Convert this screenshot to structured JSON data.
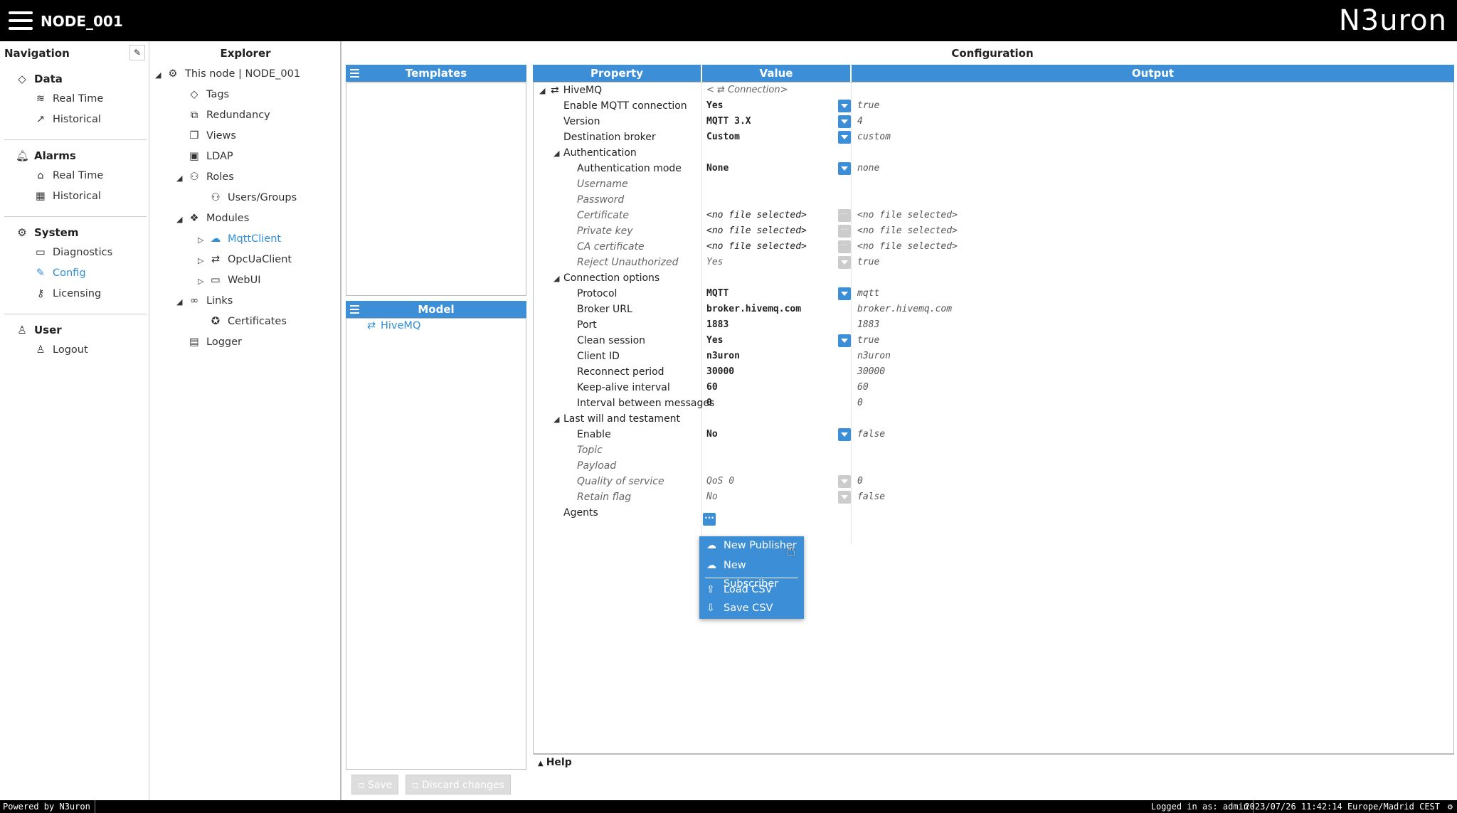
{
  "header": {
    "node_name": "NODE_001",
    "logo": "N3uron"
  },
  "navigation": {
    "title": "Navigation",
    "sections": [
      {
        "label": "Data",
        "icon": "tag-icon",
        "items": [
          {
            "label": "Real Time",
            "icon": "rss-icon"
          },
          {
            "label": "Historical",
            "icon": "chart-line-icon"
          }
        ]
      },
      {
        "label": "Alarms",
        "icon": "bell-icon",
        "items": [
          {
            "label": "Real Time",
            "icon": "alarm-rt-icon"
          },
          {
            "label": "Historical",
            "icon": "table-icon"
          }
        ]
      },
      {
        "label": "System",
        "icon": "gear-icon",
        "items": [
          {
            "label": "Diagnostics",
            "icon": "diagnostics-icon"
          },
          {
            "label": "Config",
            "icon": "edit-icon"
          },
          {
            "label": "Licensing",
            "icon": "key-icon"
          }
        ]
      },
      {
        "label": "User",
        "icon": "user-icon",
        "items": [
          {
            "label": "Logout",
            "icon": "logout-icon"
          }
        ]
      }
    ]
  },
  "explorer": {
    "title": "Explorer",
    "items": [
      "This node | NODE_001",
      "Tags",
      "Redundancy",
      "Views",
      "LDAP",
      "Roles",
      "Users/Groups",
      "Modules",
      "MqttClient",
      "OpcUaClient",
      "WebUI",
      "Links",
      "Certificates",
      "Logger"
    ]
  },
  "templates": {
    "title": "Templates"
  },
  "model": {
    "title": "Model",
    "item": "HiveMQ"
  },
  "configuration": {
    "title": "Configuration",
    "columns": {
      "property": "Property",
      "value": "Value",
      "output": "Output"
    },
    "root": {
      "label": "HiveMQ",
      "value": "< ⇄ Connection>"
    },
    "rows": [
      {
        "p": "Enable MQTT connection",
        "v": "Yes",
        "o": "true"
      },
      {
        "p": "Version",
        "v": "MQTT 3.X",
        "o": "4"
      },
      {
        "p": "Destination broker",
        "v": "Custom",
        "o": "custom"
      },
      {
        "p": "Authentication",
        "v": "",
        "o": ""
      },
      {
        "p": "Authentication mode",
        "v": "None",
        "o": "none"
      },
      {
        "p": "Username",
        "v": "",
        "o": ""
      },
      {
        "p": "Password",
        "v": "",
        "o": ""
      },
      {
        "p": "Certificate",
        "v": "<no file selected>",
        "o": "<no file selected>"
      },
      {
        "p": "Private key",
        "v": "<no file selected>",
        "o": "<no file selected>"
      },
      {
        "p": "CA certificate",
        "v": "<no file selected>",
        "o": "<no file selected>"
      },
      {
        "p": "Reject Unauthorized",
        "v": "Yes",
        "o": "true"
      },
      {
        "p": "Connection options",
        "v": "",
        "o": ""
      },
      {
        "p": "Protocol",
        "v": "MQTT",
        "o": "mqtt"
      },
      {
        "p": "Broker URL",
        "v": "broker.hivemq.com",
        "o": "broker.hivemq.com"
      },
      {
        "p": "Port",
        "v": "1883",
        "o": "1883"
      },
      {
        "p": "Clean session",
        "v": "Yes",
        "o": "true"
      },
      {
        "p": "Client ID",
        "v": "n3uron",
        "o": "n3uron"
      },
      {
        "p": "Reconnect period",
        "v": "30000",
        "o": "30000"
      },
      {
        "p": "Keep-alive interval",
        "v": "60",
        "o": "60"
      },
      {
        "p": "Interval between messages",
        "v": "0",
        "o": "0"
      },
      {
        "p": "Last will and testament",
        "v": "",
        "o": ""
      },
      {
        "p": "Enable",
        "v": "No",
        "o": "false"
      },
      {
        "p": "Topic",
        "v": "",
        "o": ""
      },
      {
        "p": "Payload",
        "v": "",
        "o": ""
      },
      {
        "p": "Quality of service",
        "v": "QoS 0",
        "o": "0"
      },
      {
        "p": "Retain flag",
        "v": "No",
        "o": "false"
      },
      {
        "p": "Agents",
        "v": "",
        "o": ""
      }
    ]
  },
  "agents_menu": [
    "New Publisher",
    "New Subscriber",
    "Load CSV",
    "Save CSV"
  ],
  "help": {
    "label": "Help"
  },
  "buttons": {
    "save": "Save",
    "discard": "Discard changes"
  },
  "statusbar": {
    "powered": "Powered by N3uron",
    "user": "Logged in as: admin",
    "datetime": "2023/07/26 11:42:14 Europe/Madrid CEST"
  },
  "colors": {
    "accent": "#3c8fd6",
    "topbar": "#000000"
  }
}
